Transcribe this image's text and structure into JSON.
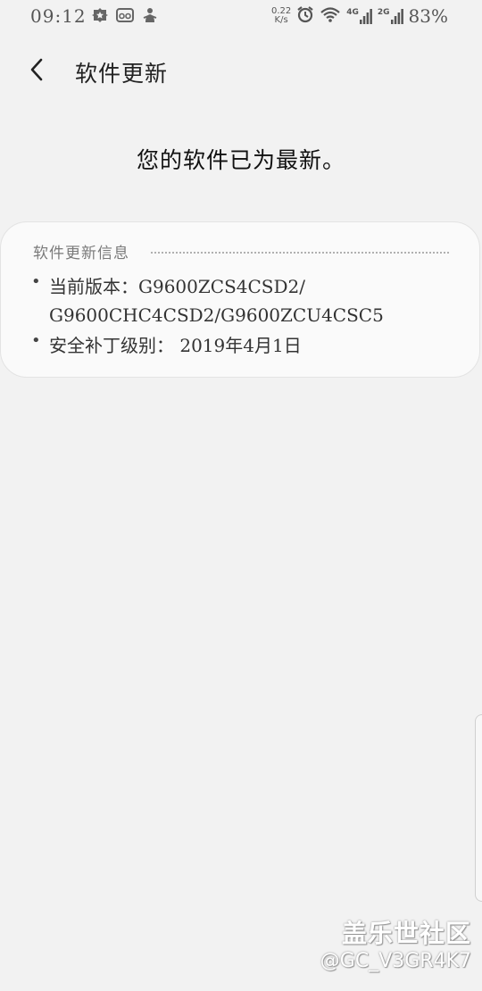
{
  "status_bar": {
    "time": "09:12",
    "net_speed_value": "0.22",
    "net_speed_unit": "K/s",
    "net_type_1": "4G",
    "net_type_2": "2G",
    "battery": "83%"
  },
  "header": {
    "title": "软件更新"
  },
  "main": {
    "status_message": "您的软件已为最新。"
  },
  "info_card": {
    "section_title": "软件更新信息",
    "current_version_line1": "当前版本：G9600ZCS4CSD2/",
    "current_version_line2": "G9600CHC4CSD2/G9600ZCU4CSC5",
    "security_patch": "安全补丁级别： 2019年4月1日"
  },
  "watermark": {
    "brand": "盖乐世社区",
    "user": "@GC_V3GR4K7"
  },
  "icons": {
    "back": "chevron-left-icon",
    "notif1": "star-badge-icon",
    "notif2": "glasses-icon",
    "notif3": "figure-icon",
    "alarm": "alarm-icon",
    "wifi": "wifi-icon",
    "signal": "signal-icon"
  }
}
